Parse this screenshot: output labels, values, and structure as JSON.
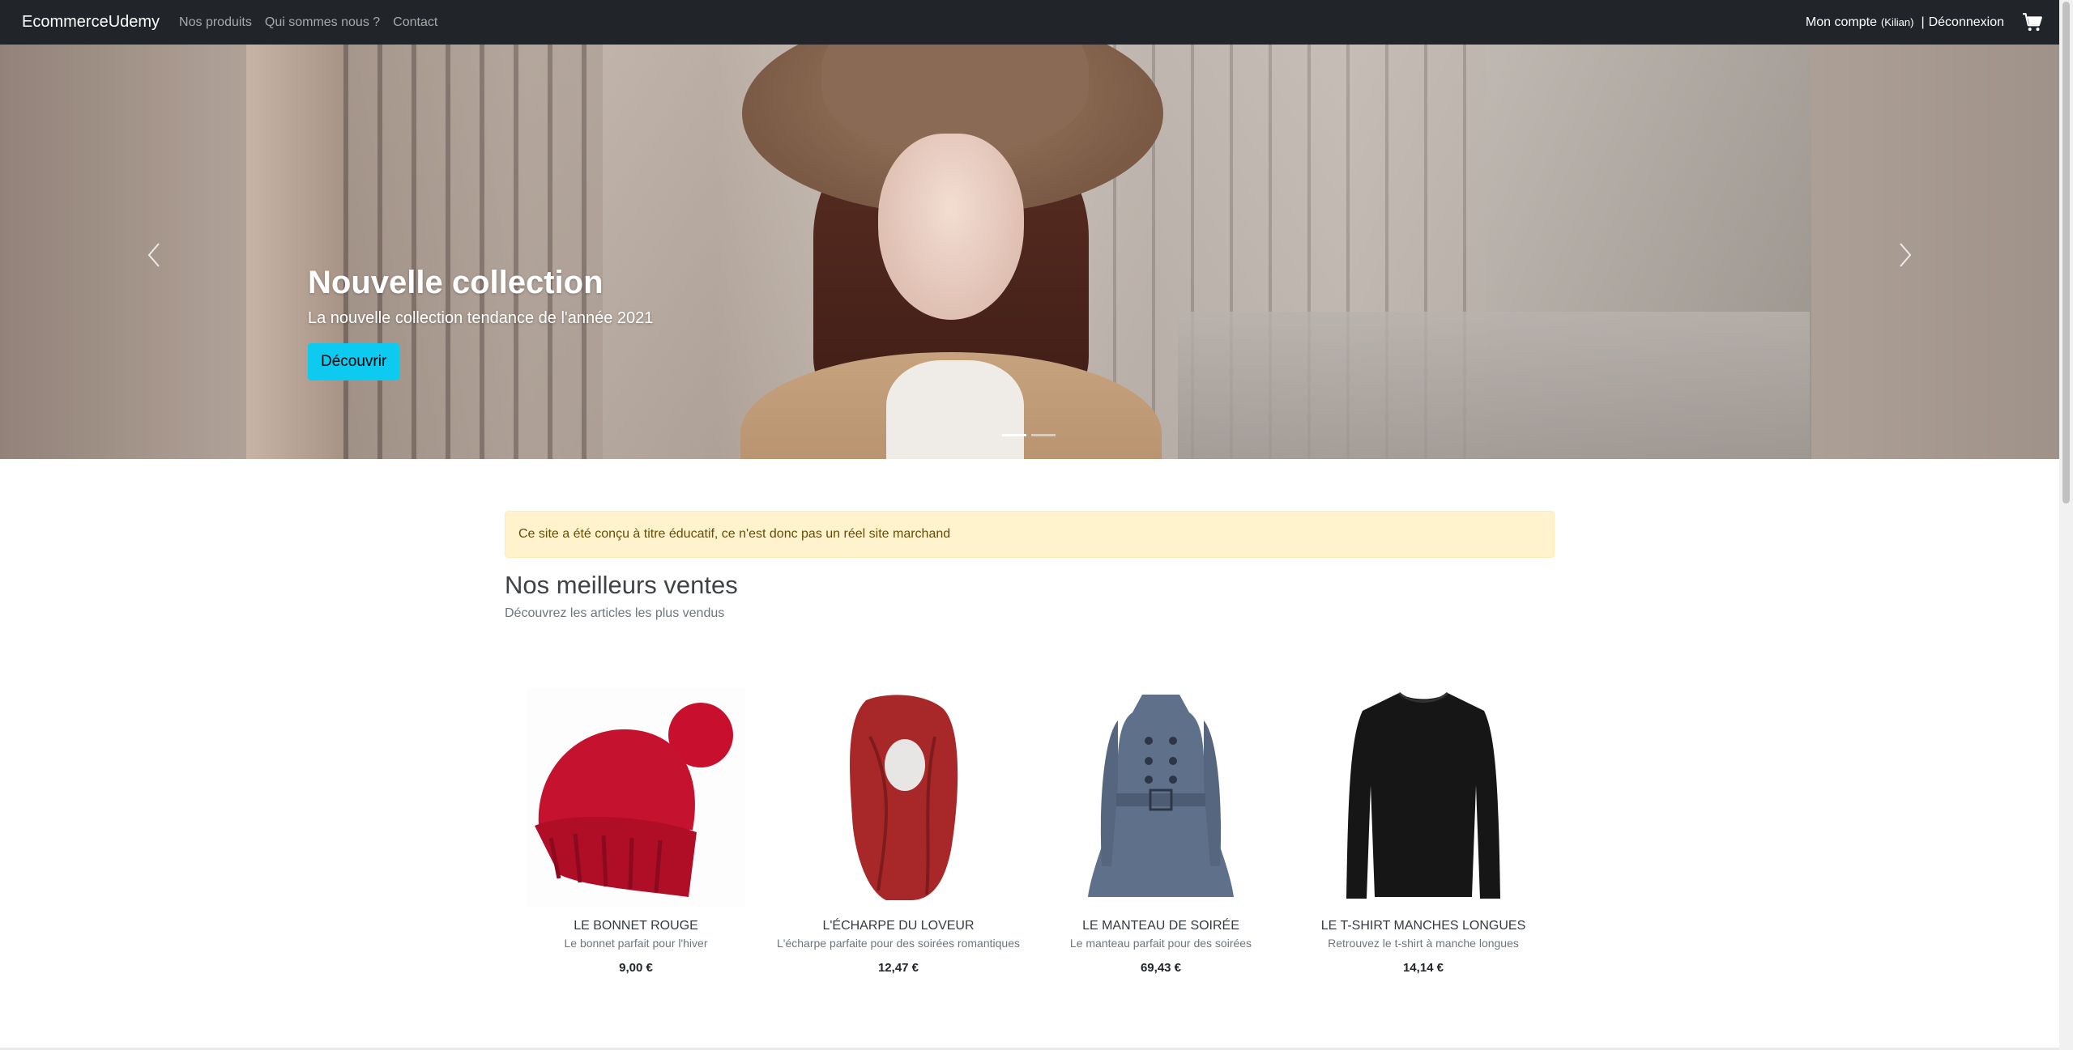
{
  "navbar": {
    "brand": "EcommerceUdemy",
    "links": [
      "Nos produits",
      "Qui sommes nous ?",
      "Contact"
    ],
    "account_label": "Mon compte",
    "account_user": "(Kilian)",
    "separator": "|",
    "logout_label": "Déconnexion",
    "cart_icon": "cart-icon"
  },
  "hero": {
    "title": "Nouvelle collection",
    "subtitle": "La nouvelle collection tendance de l'année 2021",
    "button_label": "Découvrir",
    "slide_count": 2,
    "active_slide": 1
  },
  "notice": {
    "text": "Ce site a été conçu à titre éducatif, ce n'est donc pas un réel site marchand"
  },
  "bestsellers": {
    "title": "Nos meilleurs ventes",
    "subtitle": "Découvrez les articles les plus vendus"
  },
  "products": [
    {
      "name": "Le bonnet rouge",
      "description": "Le bonnet parfait pour l'hiver",
      "price": "9,00 €",
      "image": "red-beanie"
    },
    {
      "name": "L'écharpe du loveur",
      "description": "L'écharpe parfaite pour des soirées romantiques",
      "price": "12,47 €",
      "image": "red-scarf"
    },
    {
      "name": "Le manteau de soirée",
      "description": "Le manteau parfait pour des soirées",
      "price": "69,43 €",
      "image": "blue-coat"
    },
    {
      "name": "Le t-shirt manches longues",
      "description": "Retrouvez le t-shirt à manche longues",
      "price": "14,14 €",
      "image": "black-longsleeve"
    }
  ],
  "colors": {
    "navbar_bg": "#212529",
    "button_accent": "#0dcaf0",
    "alert_bg": "#fff3cd"
  }
}
